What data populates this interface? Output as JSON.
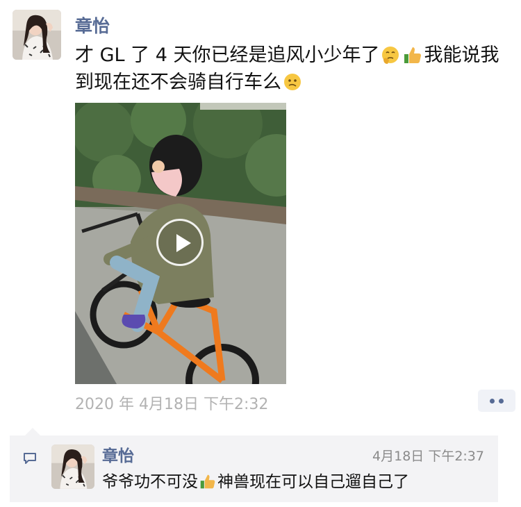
{
  "post": {
    "author": "章怡",
    "text_part1": "才 GL 了 4 天你已经是追风小少年了",
    "text_part2": "我能说我到现在还不会骑自行车么",
    "emoji_1": "thinking-face-emoji",
    "emoji_2": "thumbs-up-emoji",
    "emoji_3": "confused-face-emoji",
    "timestamp": "2020 年 4月18日 下午2:32",
    "video_label": "play-video"
  },
  "comment": {
    "author": "章怡",
    "time": "4月18日 下午2:37",
    "text_part1": "爷爷功不可没",
    "text_part2": "神兽现在可以自己遛自己了",
    "emoji": "thumbs-up-emoji"
  },
  "colors": {
    "link_blue": "#576b95",
    "timestamp_gray": "#b2b2b2",
    "comment_bg": "#f3f3f5"
  }
}
